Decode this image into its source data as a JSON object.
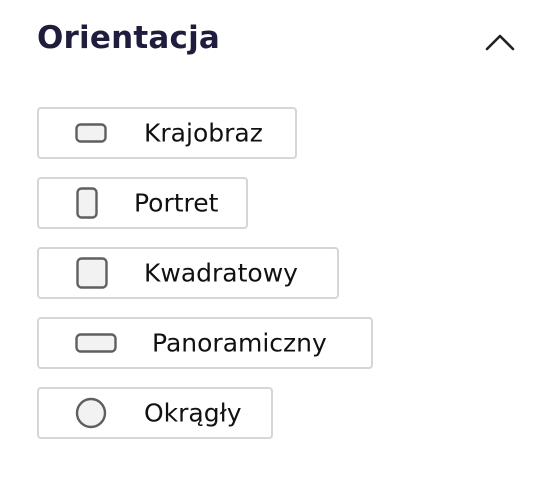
{
  "section": {
    "title": "Orientacja",
    "toggle_icon": "chevron-up-icon"
  },
  "colors": {
    "title": "#1f1d3d",
    "border": "#d6d6d6",
    "icon_stroke": "#5f5f5f",
    "icon_fill": "#f2f2f2"
  },
  "options": [
    {
      "label": "Krajobraz",
      "icon": "landscape-icon"
    },
    {
      "label": "Portret",
      "icon": "portrait-icon"
    },
    {
      "label": "Kwadratowy",
      "icon": "square-icon"
    },
    {
      "label": "Panoramiczny",
      "icon": "panorama-icon"
    },
    {
      "label": "Okrągły",
      "icon": "circle-icon"
    }
  ]
}
